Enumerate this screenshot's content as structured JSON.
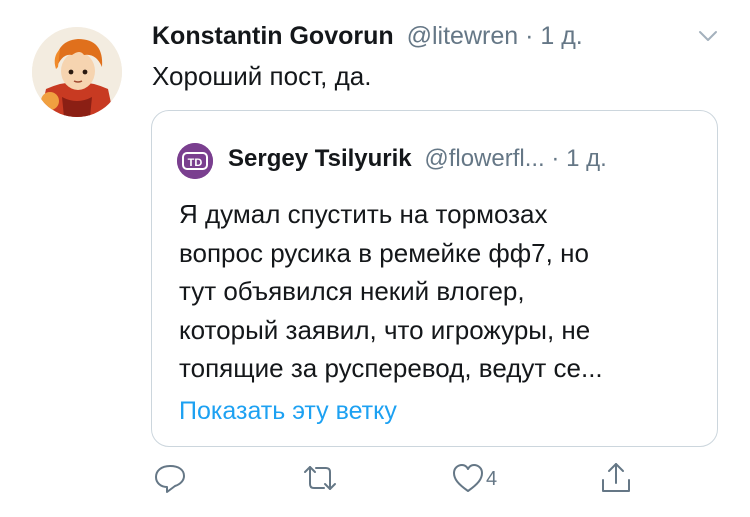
{
  "tweet": {
    "author_name": "Konstantin Govorun",
    "handle": "@litewren",
    "separator": "·",
    "time": "1 д.",
    "text": "Хороший пост, да."
  },
  "quote": {
    "author_name": "Sergey Tsilyurik",
    "handle": "@flowerfl...",
    "separator": "·",
    "time": "1 д.",
    "avatar_text": "TD",
    "lines": [
      "Я думал спустить на тормозах",
      "вопрос русика в ремейке фф7, но",
      "тут объявился некий влогер,",
      "который заявил, что игрожуры, не",
      "топящие за русперевод, ведут се..."
    ],
    "show_thread": "Показать эту ветку"
  },
  "actions": {
    "like_count": "4"
  },
  "colors": {
    "secondary_text": "#657786",
    "link": "#1da1f2",
    "border": "#ccd6dd"
  }
}
